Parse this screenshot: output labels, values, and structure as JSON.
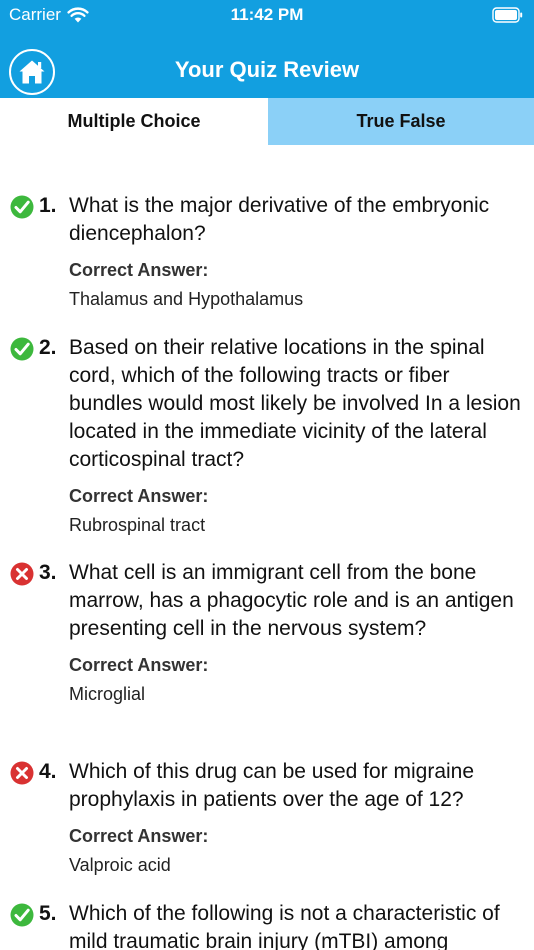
{
  "status_bar": {
    "carrier": "Carrier",
    "time": "11:42 PM",
    "wifi_icon": "wifi-icon",
    "battery_icon": "battery-icon"
  },
  "nav": {
    "title": "Your Quiz Review",
    "home_icon": "home-icon"
  },
  "colors": {
    "primary": "#129fe0",
    "tab_inactive": "#8bd0f7",
    "correct": "#3db83d",
    "incorrect": "#d93232"
  },
  "tabs": [
    {
      "label": "Multiple Choice",
      "active": true
    },
    {
      "label": "True False",
      "active": false
    }
  ],
  "answer_label": "Correct Answer:",
  "questions": [
    {
      "number": "1.",
      "status": "correct",
      "text": "What is the major derivative of the embryonic diencephalon?",
      "answer": "Thalamus and Hypothalamus"
    },
    {
      "number": "2.",
      "status": "correct",
      "text": "Based on their relative locations in the spinal cord, which of the following tracts or fiber bundles would most likely be involved In a lesion located in the immediate vicinity of the lateral corticospinal tract?",
      "answer": "Rubrospinal tract"
    },
    {
      "number": "3.",
      "status": "incorrect",
      "text": "What cell is an immigrant cell from the bone marrow, has a phagocytic role and is an antigen presenting cell in the nervous system?",
      "answer": "Microglial"
    },
    {
      "number": "4.",
      "status": "incorrect",
      "text": "Which of this drug can be used for migraine prophylaxis in patients over the age of 12?",
      "answer": "Valproic acid"
    },
    {
      "number": "5.",
      "status": "correct",
      "text": "Which of the following is not a characteristic of mild traumatic brain injury (mTBI) among",
      "answer": ""
    }
  ]
}
